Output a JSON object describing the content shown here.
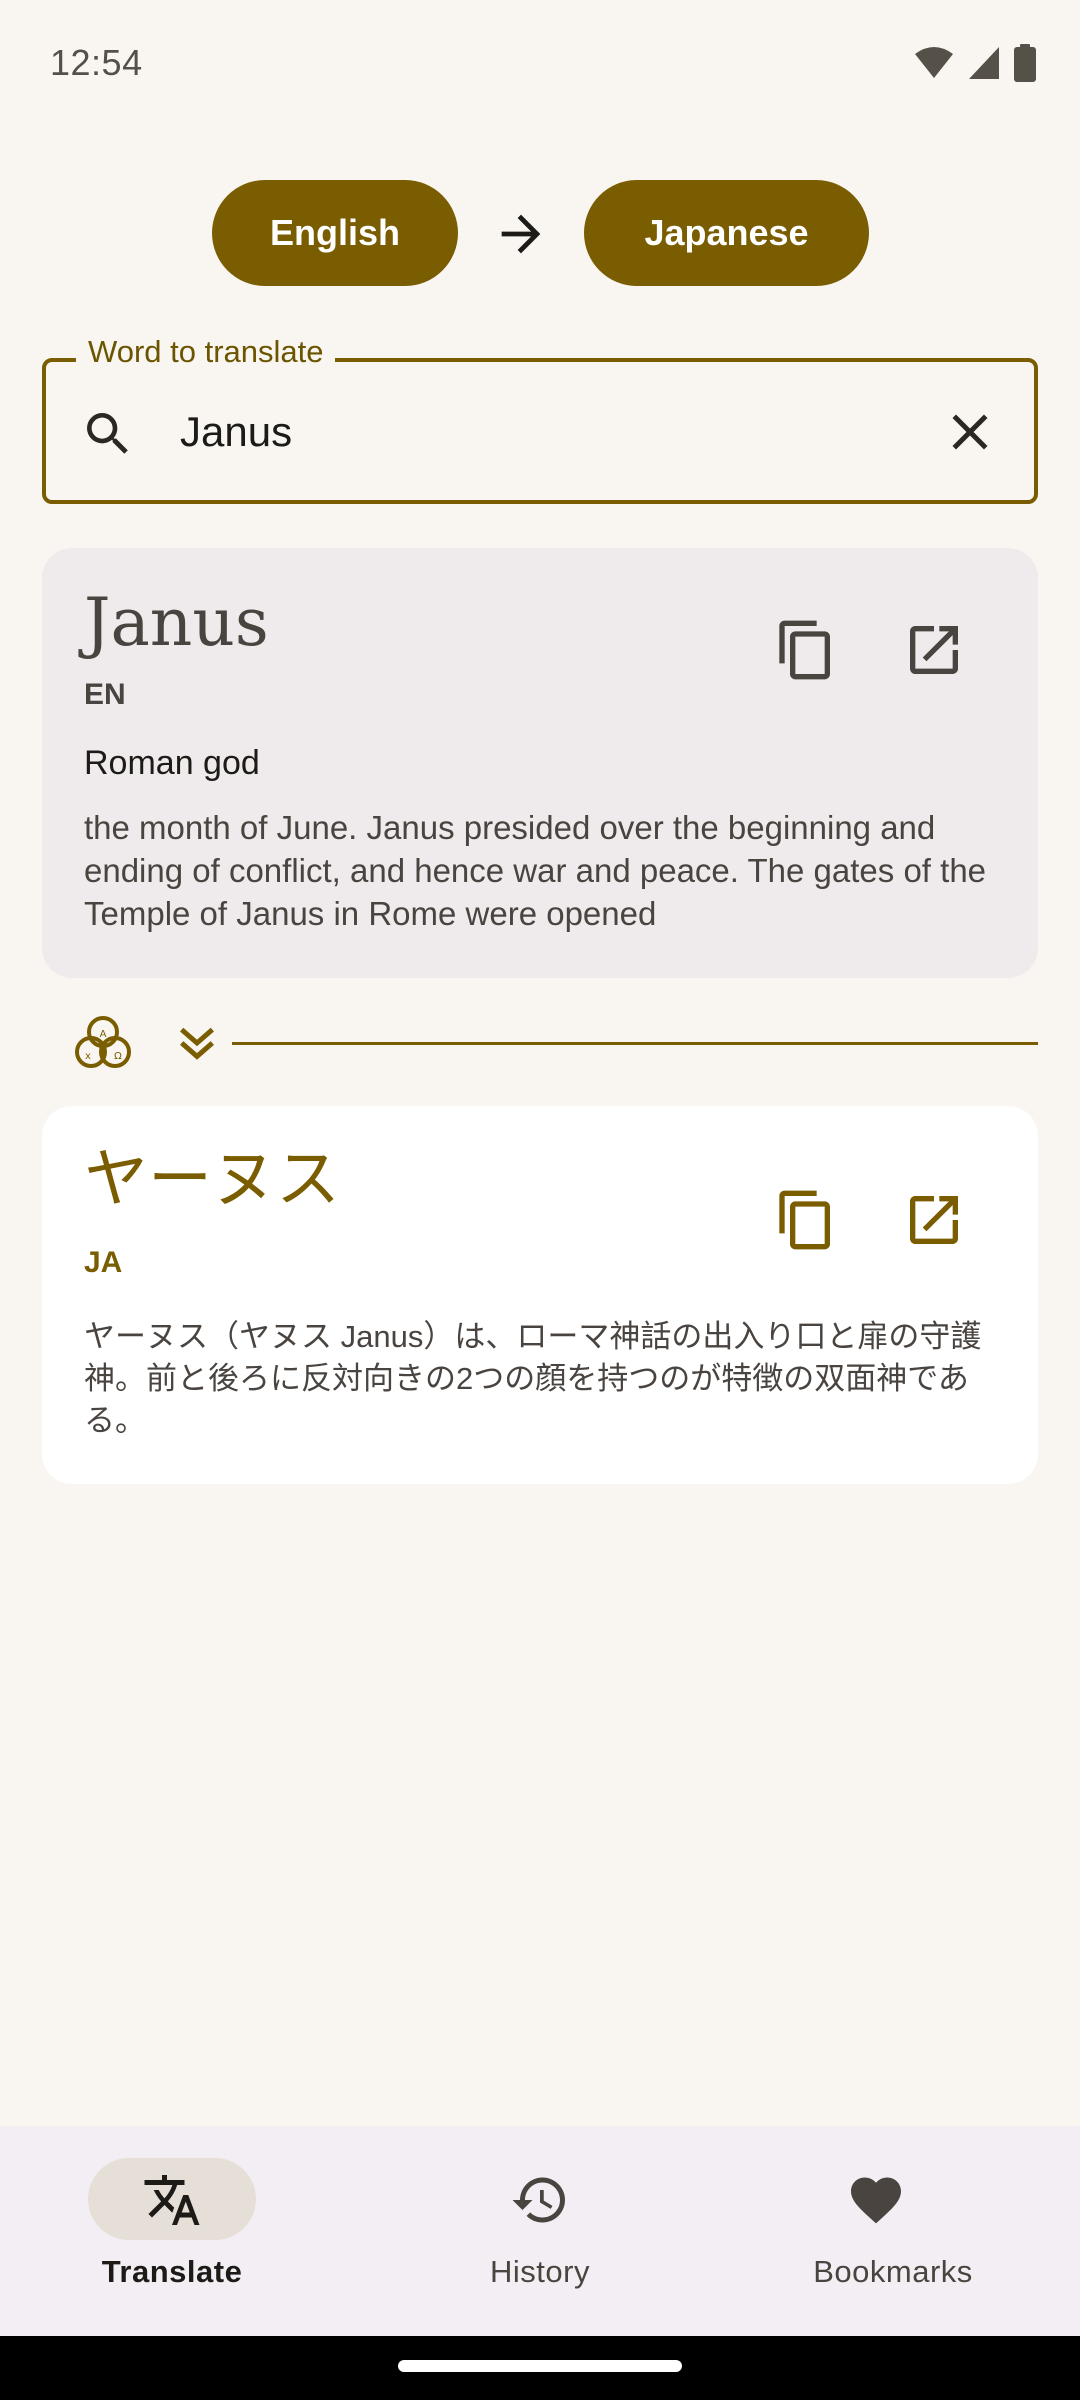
{
  "status_bar": {
    "time": "12:54",
    "icons": [
      "wifi-icon",
      "signal-icon",
      "battery-icon"
    ]
  },
  "languages": {
    "source": "English",
    "target": "Japanese"
  },
  "search": {
    "label": "Word to translate",
    "value": "Janus"
  },
  "source_card": {
    "word": "Janus",
    "lang_code": "EN",
    "subtitle": "Roman god",
    "description": "the month of June. Janus presided over the beginning and ending of conflict, and hence war and peace. The gates of the Temple of Janus in Rome were opened"
  },
  "target_card": {
    "word": "ヤーヌス",
    "lang_code": "JA",
    "description": "ヤーヌス（ヤヌス Janus）は、ローマ神話の出入り口と扉の守護神。前と後ろに反対向きの2つの顔を持つのが特徴の双面神である。"
  },
  "nav": {
    "items": [
      {
        "label": "Translate",
        "icon": "translate-icon",
        "selected": true
      },
      {
        "label": "History",
        "icon": "history-icon",
        "selected": false
      },
      {
        "label": "Bookmarks",
        "icon": "heart-icon",
        "selected": false
      }
    ]
  },
  "colors": {
    "primary": "#7A5D00",
    "background": "#F9F6F2",
    "source_card": "#EFEBEC",
    "target_card": "#FFFFFF",
    "nav_background": "#F3EEF3",
    "nav_indicator": "#E6DFD7"
  }
}
